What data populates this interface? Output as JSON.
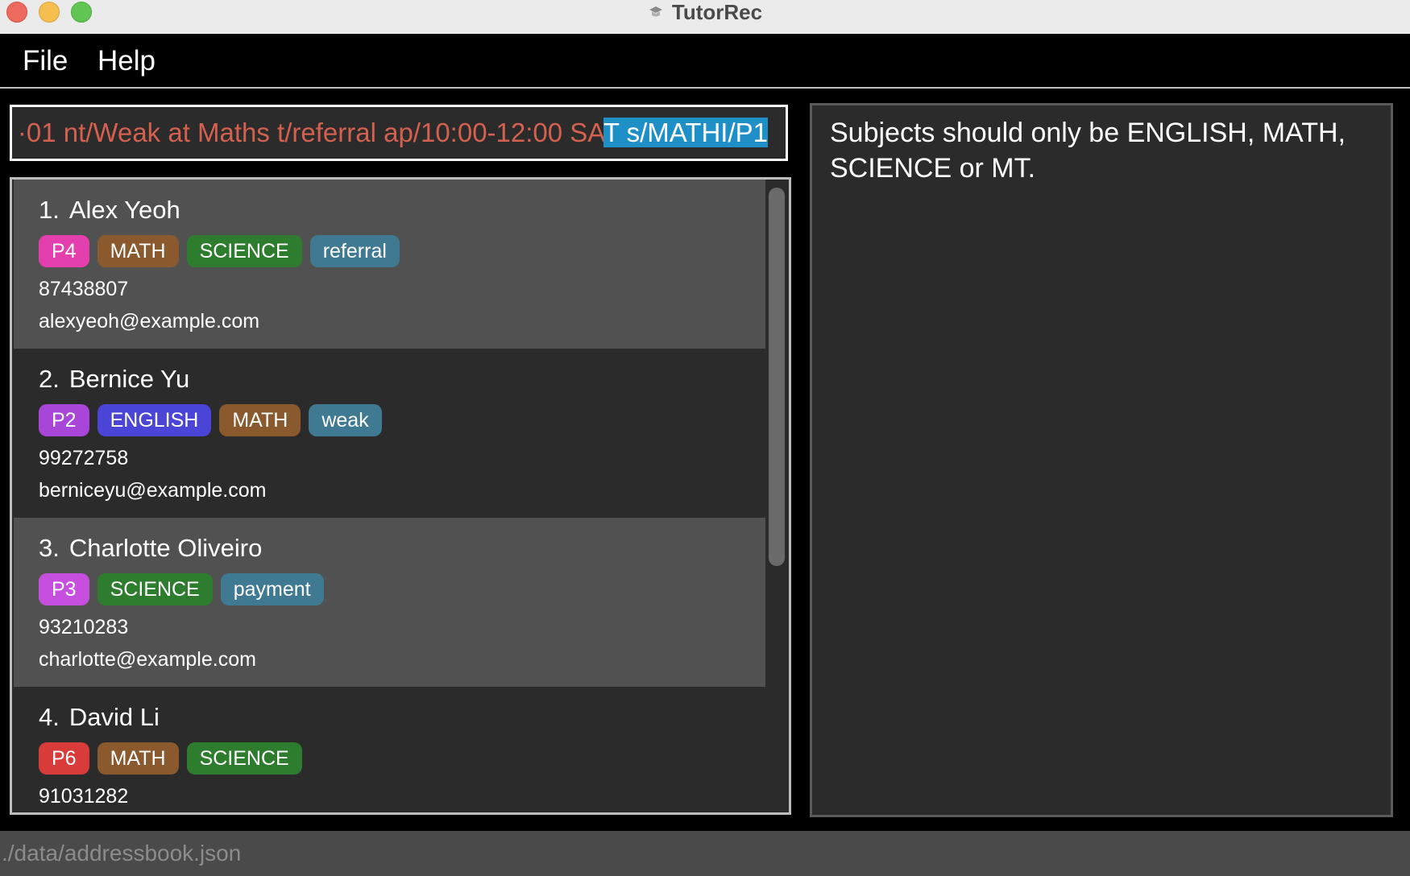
{
  "window": {
    "title": "TutorRec"
  },
  "menu": {
    "file": "File",
    "help": "Help"
  },
  "command": {
    "text_normal": "·01 nt/Weak at Maths t/referral ap/10:00-12:00 SA",
    "text_selected": "T s/MATHI/P1"
  },
  "result": {
    "message": "Subjects should only be ENGLISH, MATH, SCIENCE or MT."
  },
  "colors": {
    "tag_p4": "#e43fae",
    "tag_p2": "#a846d9",
    "tag_p3": "#c74fe0",
    "tag_p6": "#d93a3a",
    "tag_math": "#8a5a2e",
    "tag_science": "#2e7d2e",
    "tag_english": "#4a45d6",
    "tag_other": "#3f7a92",
    "command_error_text": "#d4614f",
    "selection": "#1f8fc8"
  },
  "persons": [
    {
      "index": "1.",
      "name": "Alex Yeoh",
      "tags": [
        {
          "label": "P4",
          "kind": "tag_p4"
        },
        {
          "label": "MATH",
          "kind": "tag_math"
        },
        {
          "label": "SCIENCE",
          "kind": "tag_science"
        },
        {
          "label": "referral",
          "kind": "tag_other"
        }
      ],
      "phone": "87438807",
      "email": "alexyeoh@example.com"
    },
    {
      "index": "2.",
      "name": "Bernice Yu",
      "tags": [
        {
          "label": "P2",
          "kind": "tag_p2"
        },
        {
          "label": "ENGLISH",
          "kind": "tag_english"
        },
        {
          "label": "MATH",
          "kind": "tag_math"
        },
        {
          "label": "weak",
          "kind": "tag_other"
        }
      ],
      "phone": "99272758",
      "email": "berniceyu@example.com"
    },
    {
      "index": "3.",
      "name": "Charlotte Oliveiro",
      "tags": [
        {
          "label": "P3",
          "kind": "tag_p3"
        },
        {
          "label": "SCIENCE",
          "kind": "tag_science"
        },
        {
          "label": "payment",
          "kind": "tag_other"
        }
      ],
      "phone": "93210283",
      "email": "charlotte@example.com"
    },
    {
      "index": "4.",
      "name": "David Li",
      "tags": [
        {
          "label": "P6",
          "kind": "tag_p6"
        },
        {
          "label": "MATH",
          "kind": "tag_math"
        },
        {
          "label": "SCIENCE",
          "kind": "tag_science"
        }
      ],
      "phone": "91031282",
      "email": ""
    }
  ],
  "status": {
    "path": "./data/addressbook.json"
  }
}
